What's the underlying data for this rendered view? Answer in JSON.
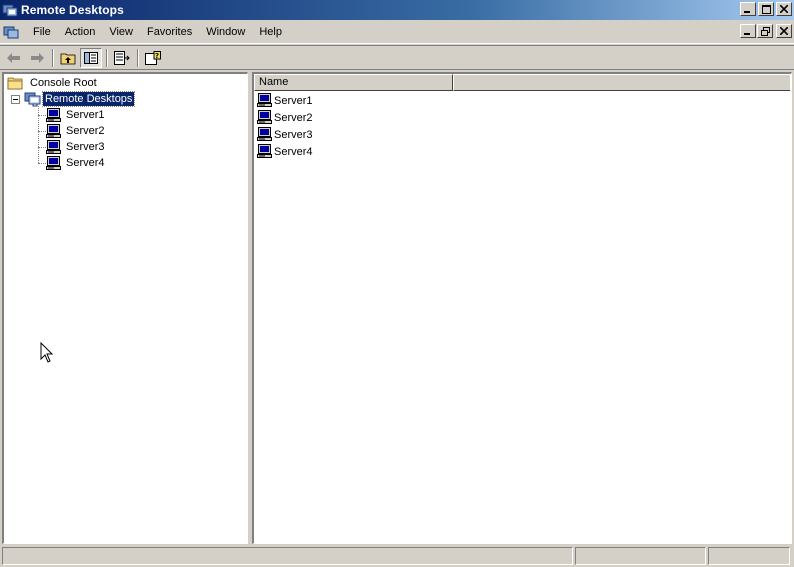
{
  "window": {
    "title": "Remote Desktops"
  },
  "menu": {
    "items": [
      {
        "label": "File"
      },
      {
        "label": "Action"
      },
      {
        "label": "View"
      },
      {
        "label": "Favorites"
      },
      {
        "label": "Window"
      },
      {
        "label": "Help"
      }
    ]
  },
  "toolbar": {
    "buttons": [
      "back-arrow-icon",
      "forward-arrow-icon",
      "up-folder-icon",
      "show-hide-tree-icon",
      "export-list-icon",
      "help-icon"
    ]
  },
  "tree": {
    "root": "Console Root",
    "snapin": "Remote Desktops",
    "children": [
      "Server1",
      "Server2",
      "Server3",
      "Server4"
    ]
  },
  "list": {
    "columns": [
      "Name"
    ],
    "rows": [
      "Server1",
      "Server2",
      "Server3",
      "Server4"
    ]
  },
  "colors": {
    "title_start": "#0a246a",
    "title_end": "#a6caf0",
    "selection": "#0a246a",
    "chrome": "#d4d0c8"
  }
}
